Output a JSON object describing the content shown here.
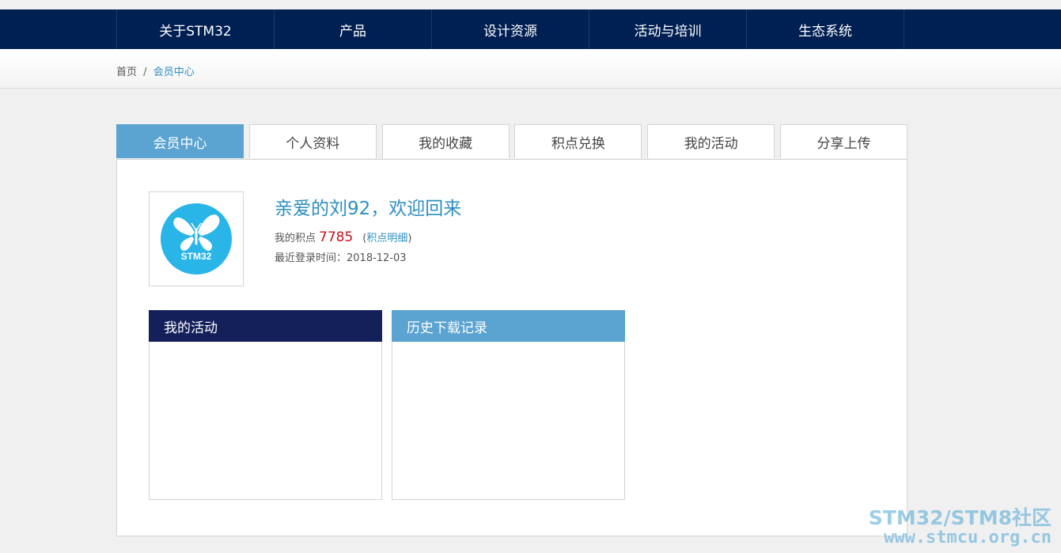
{
  "nav": {
    "items": [
      {
        "label": "关于STM32"
      },
      {
        "label": "产品"
      },
      {
        "label": "设计资源"
      },
      {
        "label": "活动与培训"
      },
      {
        "label": "生态系统"
      }
    ]
  },
  "breadcrumb": {
    "home": "首页",
    "separator": "/",
    "current": "会员中心"
  },
  "tabs": [
    {
      "label": "会员中心",
      "active": true
    },
    {
      "label": "个人资料"
    },
    {
      "label": "我的收藏"
    },
    {
      "label": "积点兑换"
    },
    {
      "label": "我的活动"
    },
    {
      "label": "分享上传"
    }
  ],
  "profile": {
    "avatar_text": "STM32",
    "welcome": "亲爱的刘92，欢迎回来",
    "points_label": "我的积点",
    "points_value": "7785",
    "points_link_open": "(",
    "points_link": "积点明细",
    "points_link_close": ")",
    "last_login": "最近登录时间：2018-12-03"
  },
  "boxes": {
    "activities_title": "我的活动",
    "downloads_title": "历史下载记录"
  },
  "watermark": {
    "line1": "STM32/STM8社区",
    "line2": "www.stmcu.org.cn"
  },
  "colors": {
    "nav_bg": "#001f52",
    "accent_blue": "#5ba3d0",
    "link_blue": "#2e8fc2",
    "dark_header": "#14205a",
    "points_red": "#c0141c",
    "logo_blue": "#29b5e8"
  }
}
